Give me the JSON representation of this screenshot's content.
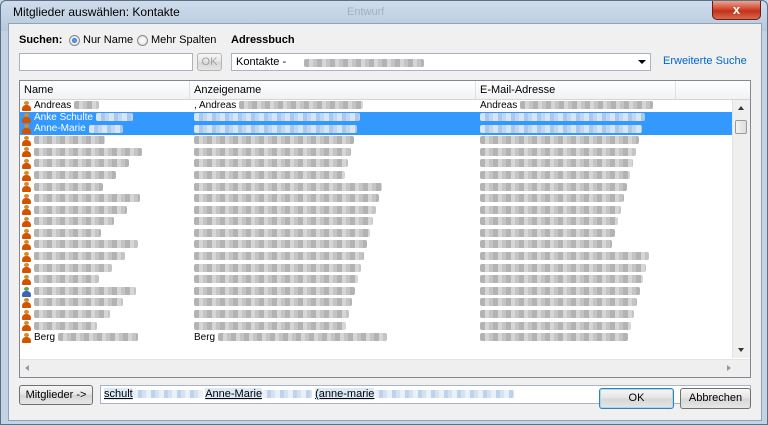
{
  "window": {
    "title": "Mitglieder auswählen: Kontakte",
    "background_title": "Entwurf",
    "close_label": "x"
  },
  "search": {
    "label": "Suchen:",
    "option_name_only": "Nur Name",
    "option_more_columns": "Mehr Spalten",
    "input_value": "",
    "ok_label": "OK"
  },
  "address_book": {
    "label": "Adressbuch",
    "selected": "Kontakte - ",
    "advanced_search_link": "Erweiterte Suche"
  },
  "table": {
    "columns": [
      "Name",
      "Anzeigename",
      "E-Mail-Adresse"
    ],
    "rows": [
      {
        "name": "Andreas",
        "display": ", Andreas",
        "email": "Andreas",
        "selected": false,
        "group": false
      },
      {
        "name": "Anke Schulte",
        "display": "",
        "email": "",
        "selected": true,
        "group": false
      },
      {
        "name": "Anne-Marie",
        "display": "",
        "email": "",
        "selected": true,
        "group": false
      },
      {
        "name": "",
        "display": "",
        "email": "",
        "selected": false,
        "group": false
      },
      {
        "name": "",
        "display": "",
        "email": "",
        "selected": false,
        "group": false
      },
      {
        "name": "",
        "display": "",
        "email": "",
        "selected": false,
        "group": false
      },
      {
        "name": "",
        "display": "",
        "email": "",
        "selected": false,
        "group": false
      },
      {
        "name": "",
        "display": "",
        "email": "",
        "selected": false,
        "group": false
      },
      {
        "name": "",
        "display": "",
        "email": "",
        "selected": false,
        "group": false
      },
      {
        "name": "",
        "display": "",
        "email": "",
        "selected": false,
        "group": false
      },
      {
        "name": "",
        "display": "",
        "email": "",
        "selected": false,
        "group": false
      },
      {
        "name": "",
        "display": "",
        "email": "",
        "selected": false,
        "group": false
      },
      {
        "name": "",
        "display": "",
        "email": "",
        "selected": false,
        "group": false
      },
      {
        "name": "",
        "display": "",
        "email": "",
        "selected": false,
        "group": false
      },
      {
        "name": "",
        "display": "",
        "email": "",
        "selected": false,
        "group": false
      },
      {
        "name": "",
        "display": "",
        "email": "",
        "selected": false,
        "group": false
      },
      {
        "name": "",
        "display": "",
        "email": "",
        "selected": false,
        "group": true
      },
      {
        "name": "",
        "display": "",
        "email": "",
        "selected": false,
        "group": false
      },
      {
        "name": "",
        "display": "",
        "email": "",
        "selected": false,
        "group": false
      },
      {
        "name": "",
        "display": "",
        "email": "",
        "selected": false,
        "group": false
      },
      {
        "name": "Berg",
        "display": "Berg",
        "email": "",
        "selected": false,
        "group": false
      }
    ]
  },
  "members": {
    "button_label": "Mitglieder ->",
    "value_part1": "schult",
    "value_part2": "Anne-Marie",
    "value_part3": "(anne-marie"
  },
  "footer": {
    "ok_label": "OK",
    "cancel_label": "Abbrechen"
  },
  "colors": {
    "selection": "#3399ff",
    "link": "#0066cc",
    "close_button": "#c0321a"
  }
}
